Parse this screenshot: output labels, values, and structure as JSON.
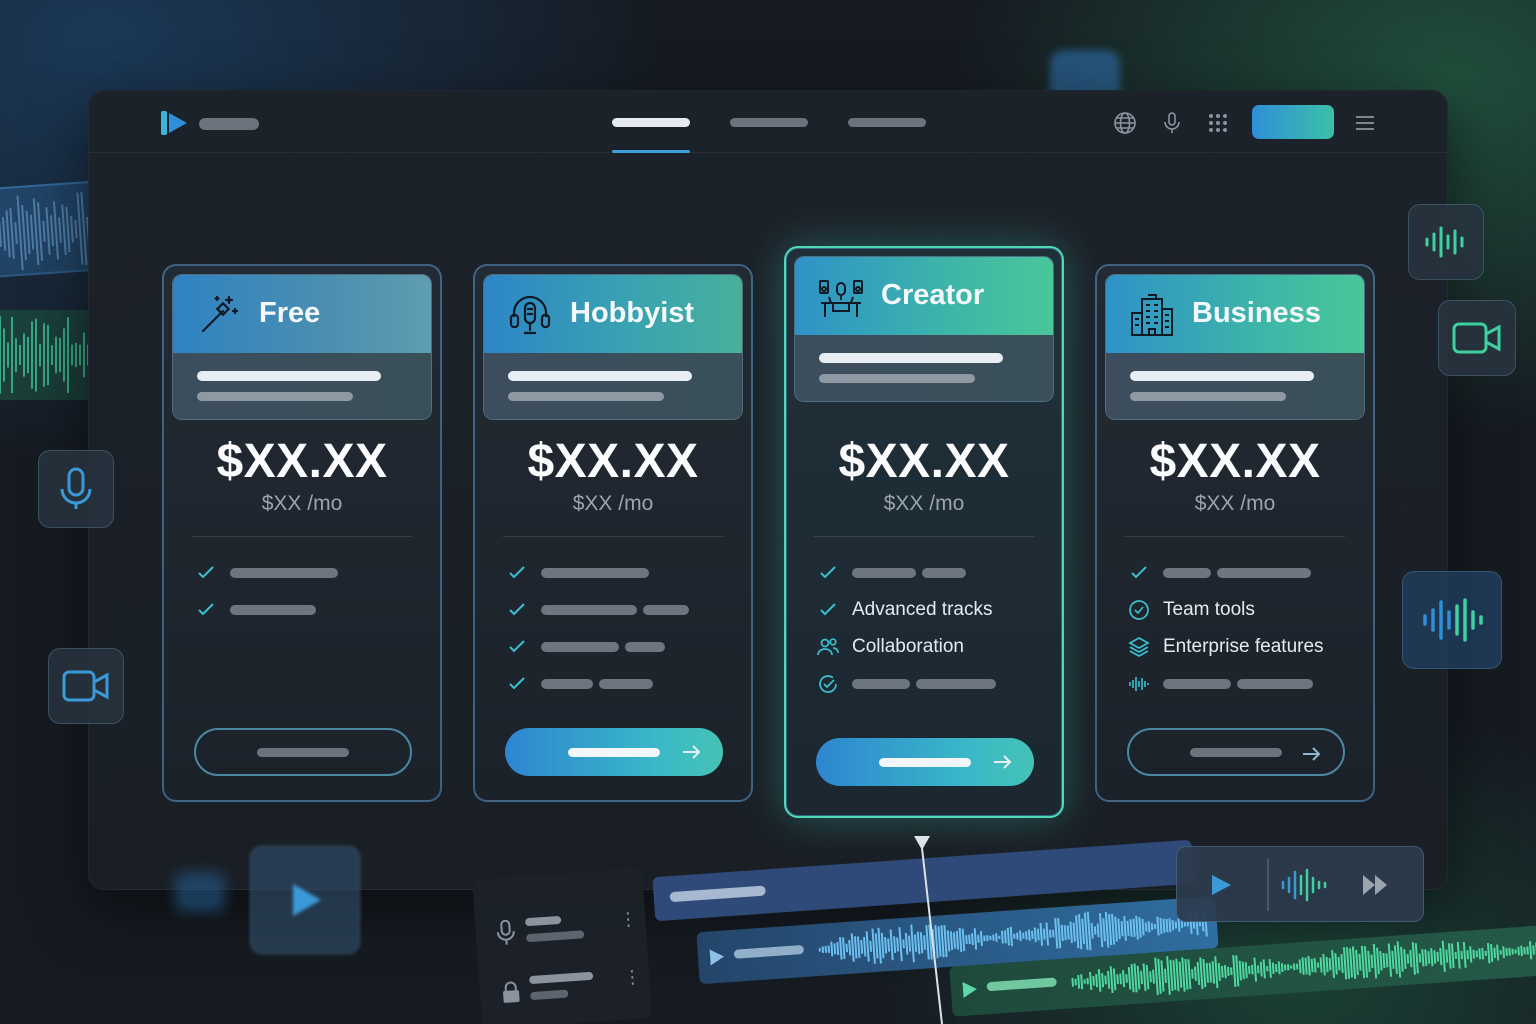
{
  "colors": {
    "accent_blue": "#2f8fd8",
    "accent_teal": "#3bc0a8",
    "featured_border": "#4fd8b8",
    "background": "#161b22"
  },
  "header": {
    "icons": [
      "globe-icon",
      "microphone-icon",
      "grid-apps-icon",
      "hamburger-menu-icon"
    ]
  },
  "plans": [
    {
      "name": "Free",
      "icon": "magic-wand-icon",
      "price": "$XX.XX",
      "per_month": "$XX /mo",
      "features": [],
      "button_style": "outline"
    },
    {
      "name": "Hobbyist",
      "icon": "headset-microphone-icon",
      "price": "$XX.XX",
      "per_month": "$XX /mo",
      "features": [],
      "button_style": "filled"
    },
    {
      "name": "Creator",
      "icon": "studio-desk-icon",
      "price": "$XX.XX",
      "per_month": "$XX /mo",
      "features": [
        "Advanced tracks",
        "Collaboration"
      ],
      "button_style": "filled",
      "featured": true
    },
    {
      "name": "Business",
      "icon": "office-building-icon",
      "price": "$XX.XX",
      "per_month": "$XX /mo",
      "features": [
        "Team tools",
        "Enterprise features"
      ],
      "button_style": "outline"
    }
  ],
  "side_icons": [
    "audio-wave-icon",
    "video-camera-icon",
    "microphone-icon",
    "video-camera-icon",
    "audio-wave-icon"
  ],
  "player": {
    "icons": [
      "play-icon",
      "audio-wave-icon",
      "fast-forward-icon"
    ]
  }
}
